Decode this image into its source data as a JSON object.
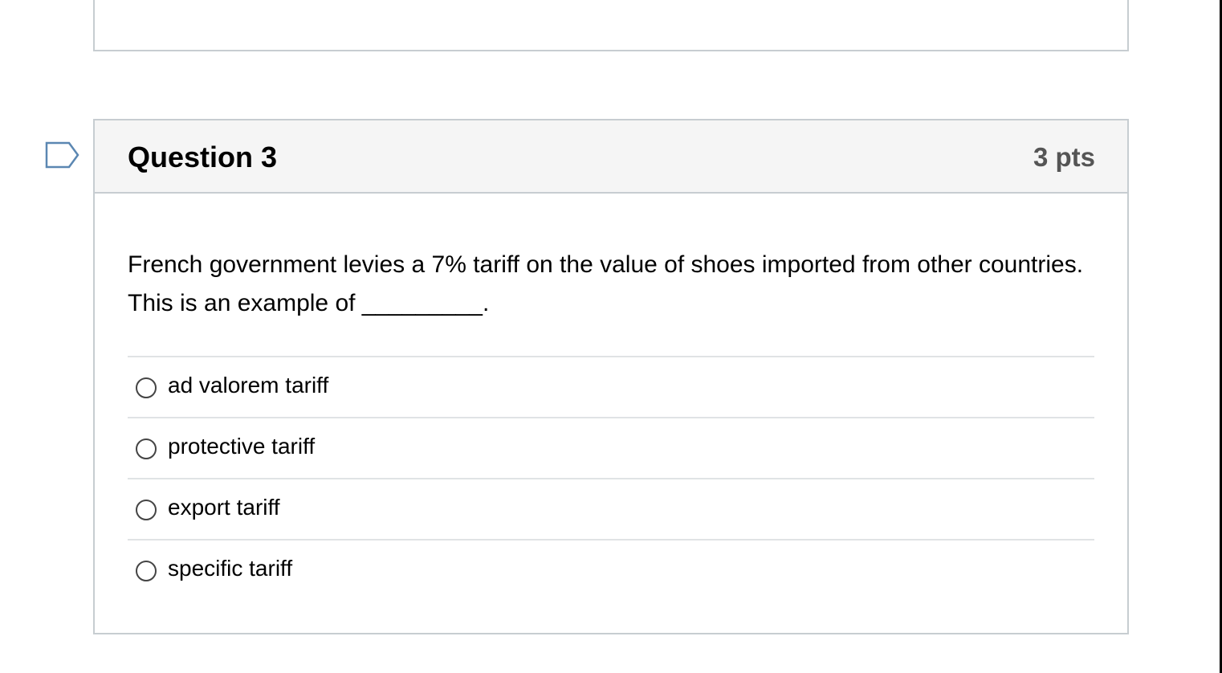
{
  "question": {
    "title": "Question 3",
    "points": "3 pts",
    "text": "French government levies a 7% tariff on the value of shoes imported from other countries. This is an example of _________.",
    "answers": [
      {
        "label": "ad valorem tariff"
      },
      {
        "label": "protective tariff"
      },
      {
        "label": "export tariff"
      },
      {
        "label": "specific tariff"
      }
    ]
  },
  "colors": {
    "header_bg": "#f5f5f5",
    "border": "#c7cdd1",
    "flag": "#5b87b2",
    "text": "#000000",
    "points": "#555555"
  },
  "icons": {
    "flag": "bookmark-flag-icon",
    "radio": "radio-button-icon"
  }
}
